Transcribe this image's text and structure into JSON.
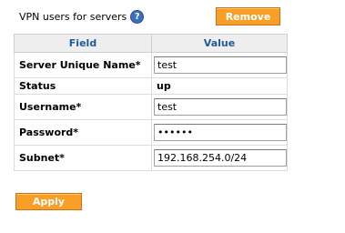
{
  "header": {
    "title": "VPN users for servers",
    "help_icon": "?"
  },
  "buttons": {
    "remove_label": "Remove",
    "apply_label": "Apply"
  },
  "table": {
    "columns": [
      "Field",
      "Value"
    ],
    "rows": [
      {
        "label": "Server Unique Name*",
        "value": "test",
        "type": "text"
      },
      {
        "label": "Status",
        "value": "up",
        "type": "static"
      },
      {
        "label": "Username*",
        "value": "test",
        "type": "text"
      },
      {
        "label": "Password*",
        "value": "••••••",
        "type": "password"
      },
      {
        "label": "Subnet*",
        "value": "192.168.254.0/24",
        "type": "text"
      }
    ]
  },
  "colors": {
    "accent_button": "#f99e27",
    "header_text": "#1f5a9c",
    "help_icon": "#3b6fbd"
  }
}
